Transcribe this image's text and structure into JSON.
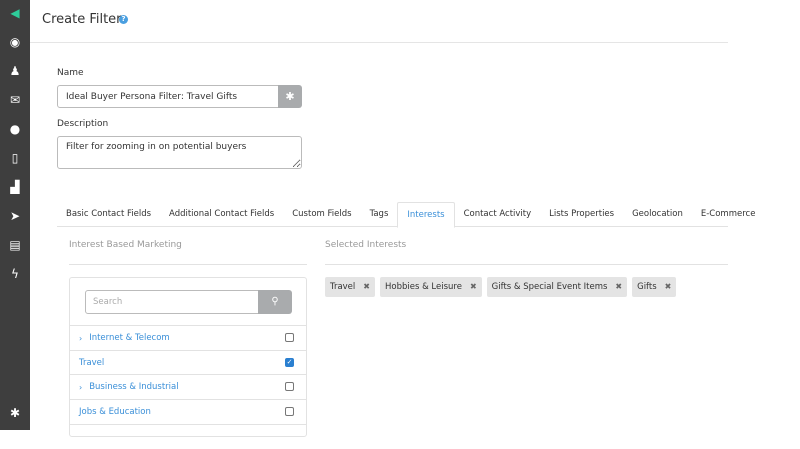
{
  "sidebar": {
    "items": [
      {
        "icon": "megaphone-icon",
        "glyph": "◀"
      },
      {
        "icon": "dashboard-icon",
        "glyph": "◉"
      },
      {
        "icon": "contacts-icon",
        "glyph": "♟"
      },
      {
        "icon": "mail-icon",
        "glyph": "✉"
      },
      {
        "icon": "microphone-icon",
        "glyph": "●"
      },
      {
        "icon": "mobile-icon",
        "glyph": "▯"
      },
      {
        "icon": "sitemap-icon",
        "glyph": "▟"
      },
      {
        "icon": "send-icon",
        "glyph": "➤"
      },
      {
        "icon": "report-icon",
        "glyph": "▤"
      },
      {
        "icon": "lightning-icon",
        "glyph": "ϟ"
      }
    ],
    "settings_glyph": "✱"
  },
  "header": {
    "title": "Create Filter",
    "help": "?"
  },
  "form": {
    "name_label": "Name",
    "name_value": "Ideal Buyer Persona Filter: Travel Gifts",
    "name_button": "✱",
    "description_label": "Description",
    "description_value": "Filter for zooming in on potential buyers"
  },
  "tabs": [
    "Basic Contact Fields",
    "Additional Contact Fields",
    "Custom Fields",
    "Tags",
    "Interests",
    "Contact Activity",
    "Lists Properties",
    "Geolocation",
    "E-Commerce"
  ],
  "interests": {
    "title": "Interest Based Marketing",
    "search_placeholder": "Search",
    "search_icon": "⚲",
    "items": [
      {
        "label": "Internet & Telecom",
        "expandable": true,
        "checked": false
      },
      {
        "label": "Travel",
        "expandable": false,
        "checked": true
      },
      {
        "label": "Business & Industrial",
        "expandable": true,
        "checked": false
      },
      {
        "label": "Jobs & Education",
        "expandable": false,
        "checked": false
      }
    ]
  },
  "selected": {
    "title": "Selected Interests",
    "chips": [
      "Travel",
      "Hobbies & Leisure",
      "Gifts & Special Event Items",
      "Gifts"
    ],
    "remove_glyph": "✖"
  },
  "colors": {
    "accent": "#3a8fd8",
    "sidebar": "#3e3e3e",
    "active_icon": "#2ecc9a"
  }
}
